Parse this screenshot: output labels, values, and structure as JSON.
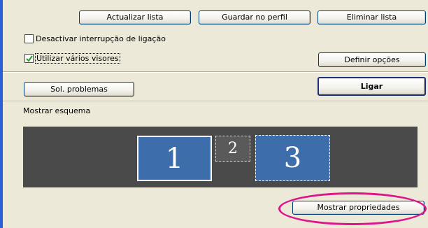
{
  "buttons": {
    "update_list": "Actualizar lista",
    "save_profile": "Guardar no perfil",
    "delete_list": "Eliminar lista",
    "set_options": "Definir opções",
    "troubleshoot": "Sol. problemas",
    "connect": "Ligar",
    "show_properties": "Mostrar propriedades"
  },
  "checkboxes": [
    {
      "label": "Desactivar interrupção de ligação",
      "checked": false
    },
    {
      "label": "Utilizar vários visores",
      "checked": true
    }
  ],
  "layout_section": {
    "label": "Mostrar esquema"
  },
  "monitors": [
    {
      "number": "1",
      "selected": true
    },
    {
      "number": "2",
      "selected": false
    },
    {
      "number": "3",
      "selected": false
    }
  ],
  "colors": {
    "accent_border": "#2a5fd6",
    "monitor_fill": "#3d6eab",
    "display_background": "#4a4a4a",
    "highlight_ellipse": "#e0148a"
  }
}
